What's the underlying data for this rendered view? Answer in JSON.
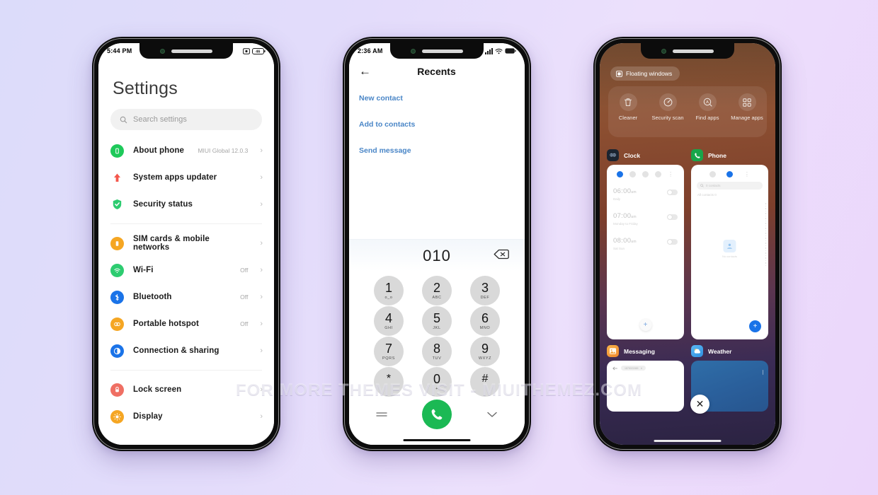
{
  "background": {
    "from": "#dcdcfa",
    "to": "#ebd6fb"
  },
  "watermark": "FOR MORE THEMES VISIT - MIUITHEMEZ.COM",
  "phone1": {
    "status": {
      "time": "5:44 PM",
      "icons": [
        "screenshot-icon",
        "battery-46-icon"
      ],
      "battery": "46"
    },
    "title": "Settings",
    "search": {
      "placeholder": "Search settings",
      "icon": "search-icon"
    },
    "groups": [
      {
        "items": [
          {
            "label": "About phone",
            "value": "MIUI Global 12.0.3",
            "icon": "phone-info-icon",
            "color": "#1ec95a"
          },
          {
            "label": "System apps updater",
            "value": "",
            "icon": "up-arrow-icon",
            "color": "#f4574c"
          },
          {
            "label": "Security status",
            "value": "",
            "icon": "shield-check-icon",
            "color": "#2dcc70"
          }
        ]
      },
      {
        "items": [
          {
            "label": "SIM cards & mobile networks",
            "value": "",
            "icon": "sim-card-icon",
            "color": "#f5a623"
          },
          {
            "label": "Wi-Fi",
            "value": "Off",
            "icon": "wifi-icon",
            "color": "#2dcc70"
          },
          {
            "label": "Bluetooth",
            "value": "Off",
            "icon": "bluetooth-icon",
            "color": "#1a73e8"
          },
          {
            "label": "Portable hotspot",
            "value": "Off",
            "icon": "hotspot-icon",
            "color": "#f5a623"
          },
          {
            "label": "Connection & sharing",
            "value": "",
            "icon": "connection-sharing-icon",
            "color": "#1a73e8"
          }
        ]
      },
      {
        "items": [
          {
            "label": "Lock screen",
            "value": "",
            "icon": "lock-icon",
            "color": "#ef6f63"
          },
          {
            "label": "Display",
            "value": "",
            "icon": "brightness-icon",
            "color": "#f5a623"
          }
        ]
      }
    ],
    "chevron": "›"
  },
  "phone2": {
    "status": {
      "time": "2:36 AM",
      "icons": [
        "signal-icon",
        "wifi-icon",
        "battery-icon"
      ]
    },
    "header": {
      "back_icon": "back-arrow-icon",
      "title": "Recents"
    },
    "actions": [
      "New contact",
      "Add to contacts",
      "Send message"
    ],
    "number": "010",
    "delete_icon": "backspace-icon",
    "keys": [
      {
        "digit": "1",
        "sub": "o_o"
      },
      {
        "digit": "2",
        "sub": "ABC"
      },
      {
        "digit": "3",
        "sub": "DEF"
      },
      {
        "digit": "4",
        "sub": "GHI"
      },
      {
        "digit": "5",
        "sub": "JKL"
      },
      {
        "digit": "6",
        "sub": "MNO"
      },
      {
        "digit": "7",
        "sub": "PQRS"
      },
      {
        "digit": "8",
        "sub": "TUV"
      },
      {
        "digit": "9",
        "sub": "WXYZ"
      },
      {
        "digit": "*",
        "sub": ""
      },
      {
        "digit": "0",
        "sub": "+"
      },
      {
        "digit": "#",
        "sub": ""
      }
    ],
    "bottom": {
      "left_icon": "keypad-menu-icon",
      "call_icon": "call-icon",
      "right_icon": "chevron-down-icon",
      "call_color": "#1bb954"
    }
  },
  "phone3": {
    "floating_windows": {
      "label": "Floating windows",
      "icon": "floating-window-icon"
    },
    "tools": [
      {
        "label": "Cleaner",
        "icon": "trash-icon"
      },
      {
        "label": "Security scan",
        "icon": "security-scan-icon"
      },
      {
        "label": "Find apps",
        "icon": "find-apps-icon"
      },
      {
        "label": "Manage apps",
        "icon": "manage-apps-icon"
      }
    ],
    "cards": [
      {
        "app": "Clock",
        "icon": "clock-app-icon",
        "icon_bg": "#1b2430",
        "alarms": [
          {
            "time": "06:00",
            "ampm": "am",
            "repeat": "Daily",
            "enabled": false
          },
          {
            "time": "07:00",
            "ampm": "am",
            "repeat": "Monday to Friday",
            "enabled": false
          },
          {
            "time": "08:00",
            "ampm": "am",
            "repeat": "Sat Sun",
            "enabled": false
          }
        ],
        "fab": "+"
      },
      {
        "app": "Phone",
        "icon": "phone-app-icon",
        "icon_bg": "#17a64a",
        "search_placeholder": "0 contacts",
        "all_contacts": "All contacts  0",
        "empty_text": "No contacts",
        "fab": "+"
      },
      {
        "app": "Messaging",
        "icon": "messaging-app-icon",
        "icon_bg": "#f5a623",
        "chip": "1875021869"
      },
      {
        "app": "Weather",
        "icon": "weather-app-icon",
        "icon_bg": "#3aa6f0"
      }
    ],
    "close_icon": "close-icon"
  }
}
